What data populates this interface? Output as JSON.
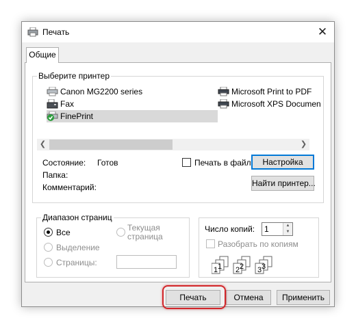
{
  "window": {
    "title": "Печать",
    "close_glyph": "✕"
  },
  "tabs": [
    {
      "label": "Общие"
    }
  ],
  "printer_group": {
    "legend": "Выберите принтер"
  },
  "printers": [
    {
      "name": "Canon MG2200 series",
      "icon": "printer-icon"
    },
    {
      "name": "Fax",
      "icon": "fax-icon"
    },
    {
      "name": "FinePrint",
      "icon": "printer-default-icon",
      "selected": true
    },
    {
      "name": "Microsoft Print to PDF",
      "icon": "printer-icon"
    },
    {
      "name": "Microsoft XPS Documen",
      "icon": "printer-icon"
    }
  ],
  "status": {
    "label": "Состояние:",
    "value": "Готов"
  },
  "folder": {
    "label": "Папка:",
    "value": ""
  },
  "comment": {
    "label": "Комментарий:",
    "value": ""
  },
  "print_to_file": {
    "label": "Печать в файл",
    "checked": false
  },
  "buttons": {
    "setup": "Настройка",
    "find_printer": "Найти принтер...",
    "print": "Печать",
    "cancel": "Отмена",
    "apply": "Применить"
  },
  "page_range": {
    "legend": "Диапазон страниц",
    "options": [
      {
        "label": "Все",
        "checked": true,
        "enabled": true
      },
      {
        "label": "Текущая страница",
        "line1": "Текущая",
        "line2": "страница",
        "checked": false,
        "enabled": false
      },
      {
        "label": "Выделение",
        "checked": false,
        "enabled": false
      },
      {
        "label": "Страницы:",
        "checked": false,
        "enabled": false
      }
    ],
    "pages_value": ""
  },
  "copies": {
    "label": "Число копий:",
    "value": "1",
    "collate_label": "Разобрать по копиям",
    "collate_checked": false
  },
  "colors": {
    "highlight": "#d2262a",
    "accent": "#0078d7"
  }
}
